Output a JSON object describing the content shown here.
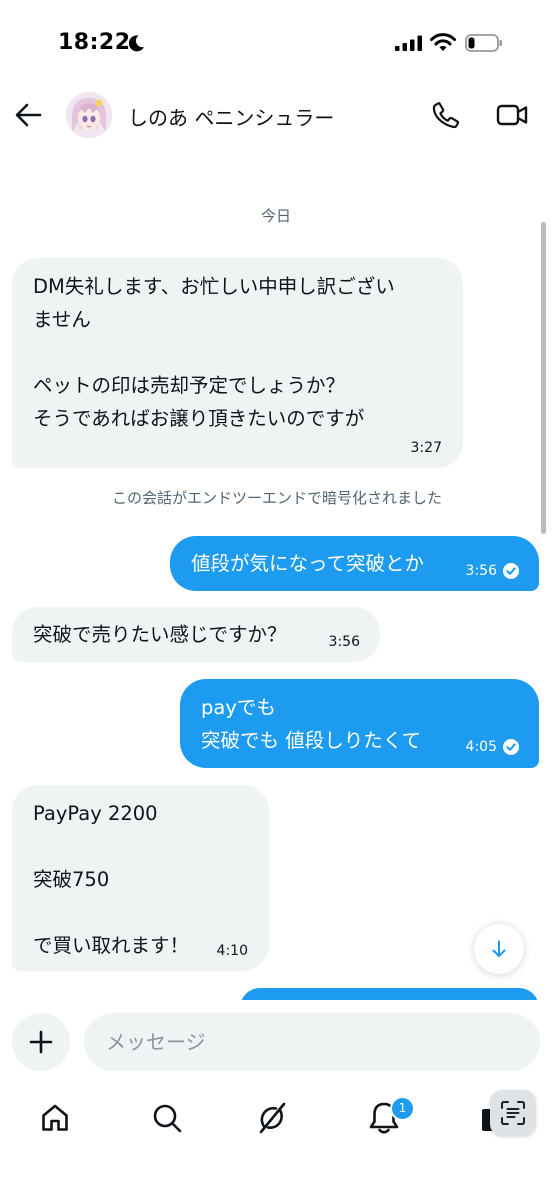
{
  "status_bar": {
    "time": "18:22",
    "icons": [
      "moon-icon",
      "signal-icon",
      "wifi-icon",
      "battery-icon"
    ],
    "battery_level": 0.2
  },
  "header": {
    "contact_name": "しのあ ペニンシュラー",
    "icons": [
      "back-arrow-icon",
      "phone-icon",
      "video-call-icon"
    ]
  },
  "conversation": {
    "date_label": "今日",
    "encryption_notice": "この会話がエンドツーエンドで暗号化されました",
    "messages": [
      {
        "direction": "incoming",
        "lines": [
          "DM失礼します、お忙しい中申し訳ござい",
          "ません",
          "",
          "ペットの印は売却予定でしょうか？",
          "そうであればお譲り頂きたいのですが"
        ],
        "time": "3:27"
      },
      {
        "direction": "outgoing",
        "lines": [
          "値段が気になって突破とか"
        ],
        "time": "3:56",
        "read": true
      },
      {
        "direction": "incoming",
        "lines": [
          "突破で売りたい感じですか？"
        ],
        "time": "3:56"
      },
      {
        "direction": "outgoing",
        "lines": [
          "payでも",
          "突破でも 値段しりたくて"
        ],
        "time": "4:05",
        "read": true
      },
      {
        "direction": "incoming",
        "lines": [
          "PayPay 2200",
          "",
          "突破750",
          "",
          "で買い取れます！"
        ],
        "time": "4:10"
      }
    ]
  },
  "composer": {
    "placeholder": "メッセージ"
  },
  "bottom_nav": {
    "items": [
      "home-icon",
      "search-icon",
      "grok-icon",
      "notifications-icon",
      "messages-icon"
    ],
    "notification_count": "1"
  },
  "colors": {
    "accent": "#1d9bf0",
    "incoming_bubble": "#eff3f4",
    "secondary_text": "#536471"
  }
}
